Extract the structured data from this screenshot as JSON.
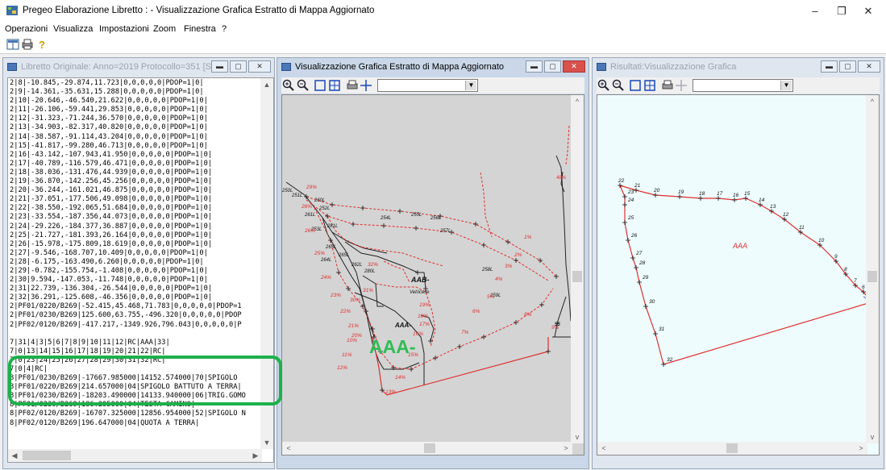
{
  "app": {
    "title": "Pregeo Elaborazione Libretto : - Visualizzazione Grafica Estratto di Mappa Aggiornato",
    "minimize": "–",
    "maximize": "❐",
    "close": "✕"
  },
  "menu": [
    "Operazioni",
    "Visualizza",
    "Impostazioni",
    "Zoom",
    "Finestra",
    "?"
  ],
  "windows": {
    "libretto": {
      "title": "Libretto Originale: Anno=2019 Protocollo=351 [S]",
      "lines": [
        "2|8|-10.845,-29.874,11.723|0,0,0,0,0|PDOP=1|0|",
        "2|9|-14.361,-35.631,15.288|0,0,0,0,0|PDOP=1|0|",
        "2|10|-20.646,-46.540,21.622|0,0,0,0,0|PDOP=1|0|",
        "2|11|-26.106,-59.441,29.853|0,0,0,0,0|PDOP=1|0|",
        "2|12|-31.323,-71.244,36.570|0,0,0,0,0|PDOP=1|0|",
        "2|13|-34.903,-82.317,40.820|0,0,0,0,0|PDOP=1|0|",
        "2|14|-38.587,-91.114,43.204|0,0,0,0,0|PDOP=1|0|",
        "2|15|-41.817,-99.280,46.713|0,0,0,0,0|PDOP=1|0|",
        "2|16|-43.142,-107.943,41.950|0,0,0,0,0|PDOP=1|0|",
        "2|17|-40.789,-116.579,46.471|0,0,0,0,0|PDOP=1|0|",
        "2|18|-38.036,-131.476,44.939|0,0,0,0,0|PDOP=1|0|",
        "2|19|-36.870,-142.256,45.256|0,0,0,0,0|PDOP=1|0|",
        "2|20|-36.244,-161.021,46.875|0,0,0,0,0|PDOP=1|0|",
        "2|21|-37.051,-177.506,49.098|0,0,0,0,0|PDOP=1|0|",
        "2|22|-38.550,-192.065,51.684|0,0,0,0,0|PDOP=1|0|",
        "2|23|-33.554,-187.356,44.073|0,0,0,0,0|PDOP=1|0|",
        "2|24|-29.226,-184.377,36.887|0,0,0,0,0|PDOP=1|0|",
        "2|25|-21.727,-181.393,26.164|0,0,0,0,0|PDOP=1|0|",
        "2|26|-15.978,-175.809,18.619|0,0,0,0,0|PDOP=1|0|",
        "2|27|-9.546,-168.707,10.409|0,0,0,0,0|PDOP=1|0|",
        "2|28|-6.175,-163.490,6.260|0,0,0,0,0|PDOP=1|0|",
        "2|29|-0.782,-155.754,-1.408|0,0,0,0,0|PDOP=1|0|",
        "2|30|9.594,-147.053,-11.748|0,0,0,0,0|PDOP=1|0|",
        "2|31|22.739,-136.304,-26.544|0,0,0,0,0|PDOP=1|0|",
        "2|32|36.291,-125.608,-46.356|0,0,0,0,0|PDOP=1|0|",
        "2|PF01/0220/B269|-52.415,45.468,71.783|0,0,0,0,0|PDOP=1",
        "2|PF01/0230/B269|125.600,63.755,-496.320|0,0,0,0,0|PDOP",
        "2|PF02/0120/B269|-417.217,-1349.926,796.043|0,0,0,0,0|P",
        "",
        "7|31|4|3|5|6|7|8|9|10|11|12|RC|AAA|33|",
        "7|0|13|14|15|16|17|18|19|20|21|22|RC|",
        "7|0|23|24|25|26|27|28|29|30|31|32|RC|",
        "7|0|4|RC|",
        "8|PF01/0230/B269|-17667.985000|14152.574000|70|SPIGOLO",
        "8|PF01/0220/B269|214.657000|04|SPIGOLO BATTUTO A TERRA|",
        "8|PF01/0230/B269|-18203.490000|14133.940000|06|TRIG.GOMO",
        "8|PF01/0230/B269|186.295000|04|TESTA CAMINO|",
        "8|PF02/0120/B269|-16707.325000|12856.954000|52|SPIGOLO N",
        "8|PF02/0120/B269|196.647000|04|QUOTA A TERRA|"
      ]
    },
    "estratto": {
      "title": "Visualizzazione Grafica Estratto di Mappa Aggiornato",
      "overlay_label": "AAA-",
      "labels": {
        "aab": "AAB-",
        "vetricelle": "Vetricelle",
        "aaa_small": "AAA-",
        "fiftyfive": "55",
        "fortyeight": "48%"
      },
      "plabels": [
        "250L",
        "251L",
        "252L",
        "253L",
        "254L",
        "255L",
        "256L",
        "257L",
        "258L",
        "259L",
        "260L",
        "261L",
        "262L",
        "263L",
        "264L",
        "265L",
        "280L",
        "281L"
      ],
      "rlabels": [
        "1%",
        "2%",
        "3%",
        "4%",
        "5%",
        "6%",
        "7%",
        "8%",
        "9%",
        "10%",
        "11%",
        "12%",
        "13%",
        "14%",
        "15%",
        "16%",
        "17%",
        "18%",
        "19%",
        "20%",
        "21%",
        "22%",
        "23%",
        "24%",
        "25%",
        "26%",
        "28%",
        "29%",
        "30%",
        "31%",
        "32%"
      ]
    },
    "risultati": {
      "title": "Risultati:Visualizzazione Grafica",
      "area_label": "AAA",
      "points": [
        "22",
        "21",
        "20",
        "19",
        "18",
        "17",
        "16",
        "15",
        "14",
        "13",
        "12",
        "11",
        "10",
        "9",
        "8",
        "7",
        "6",
        "5",
        "23",
        "24",
        "25",
        "26",
        "27",
        "28",
        "29",
        "30",
        "31",
        "32"
      ]
    }
  },
  "colors": {
    "polygon": "#e03030",
    "highlight": "#1db14a",
    "map_bg": "#d4d4d4",
    "result_bg": "#eefcfe"
  }
}
